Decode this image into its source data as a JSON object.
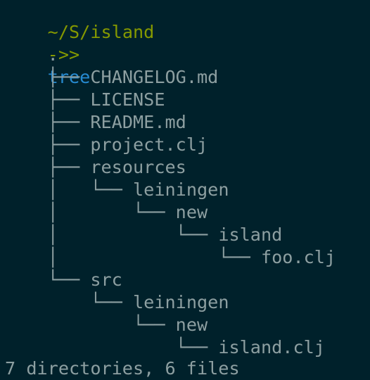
{
  "prompt": {
    "path": "~/S/island",
    "arrow": "->>",
    "command": "tree"
  },
  "tree": [
    {
      "prefix": "",
      "name": "."
    },
    {
      "prefix": "├── ",
      "name": "CHANGELOG.md"
    },
    {
      "prefix": "├── ",
      "name": "LICENSE"
    },
    {
      "prefix": "├── ",
      "name": "README.md"
    },
    {
      "prefix": "├── ",
      "name": "project.clj"
    },
    {
      "prefix": "├── ",
      "name": "resources"
    },
    {
      "prefix": "│   └── ",
      "name": "leiningen"
    },
    {
      "prefix": "│       └── ",
      "name": "new"
    },
    {
      "prefix": "│           └── ",
      "name": "island"
    },
    {
      "prefix": "│               └── ",
      "name": "foo.clj"
    },
    {
      "prefix": "└── ",
      "name": "src"
    },
    {
      "prefix": "    └── ",
      "name": "leiningen"
    },
    {
      "prefix": "        └── ",
      "name": "new"
    },
    {
      "prefix": "            └── ",
      "name": "island.clj"
    }
  ],
  "summary": "7 directories, 6 files",
  "colors": {
    "background": "#00212b",
    "text": "#8d9fa1",
    "prompt_path": "#859900",
    "command": "#268bd2"
  }
}
